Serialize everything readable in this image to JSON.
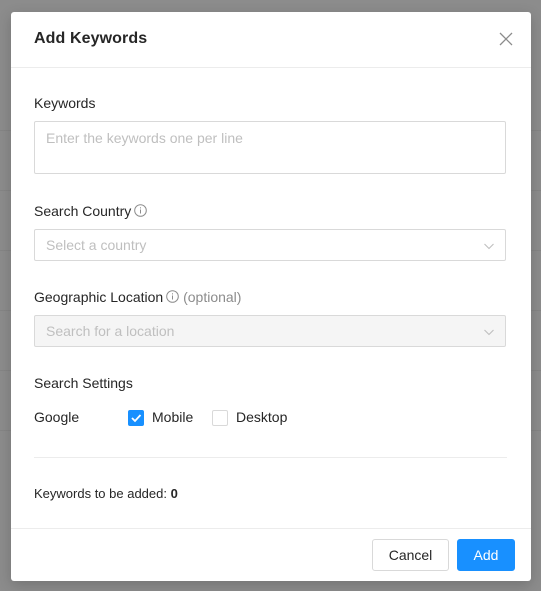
{
  "modal": {
    "title": "Add Keywords"
  },
  "keywords": {
    "label": "Keywords",
    "placeholder": "Enter the keywords one per line"
  },
  "country": {
    "label": "Search Country",
    "placeholder": "Select a country"
  },
  "location": {
    "label": "Geographic Location",
    "optional": "(optional)",
    "placeholder": "Search for a location",
    "disabled": true
  },
  "settings": {
    "label": "Search Settings",
    "engine": "Google",
    "options": [
      {
        "label": "Mobile",
        "checked": true
      },
      {
        "label": "Desktop",
        "checked": false
      }
    ]
  },
  "summary": {
    "label": "Keywords to be added:",
    "count": "0"
  },
  "footer": {
    "cancel_label": "Cancel",
    "add_label": "Add"
  },
  "colors": {
    "primary": "#1890ff",
    "border": "#d9d9d9",
    "placeholder": "#bfbfbf"
  },
  "icons": [
    "close-icon",
    "info-icon",
    "chevron-down-icon",
    "check-icon"
  ]
}
